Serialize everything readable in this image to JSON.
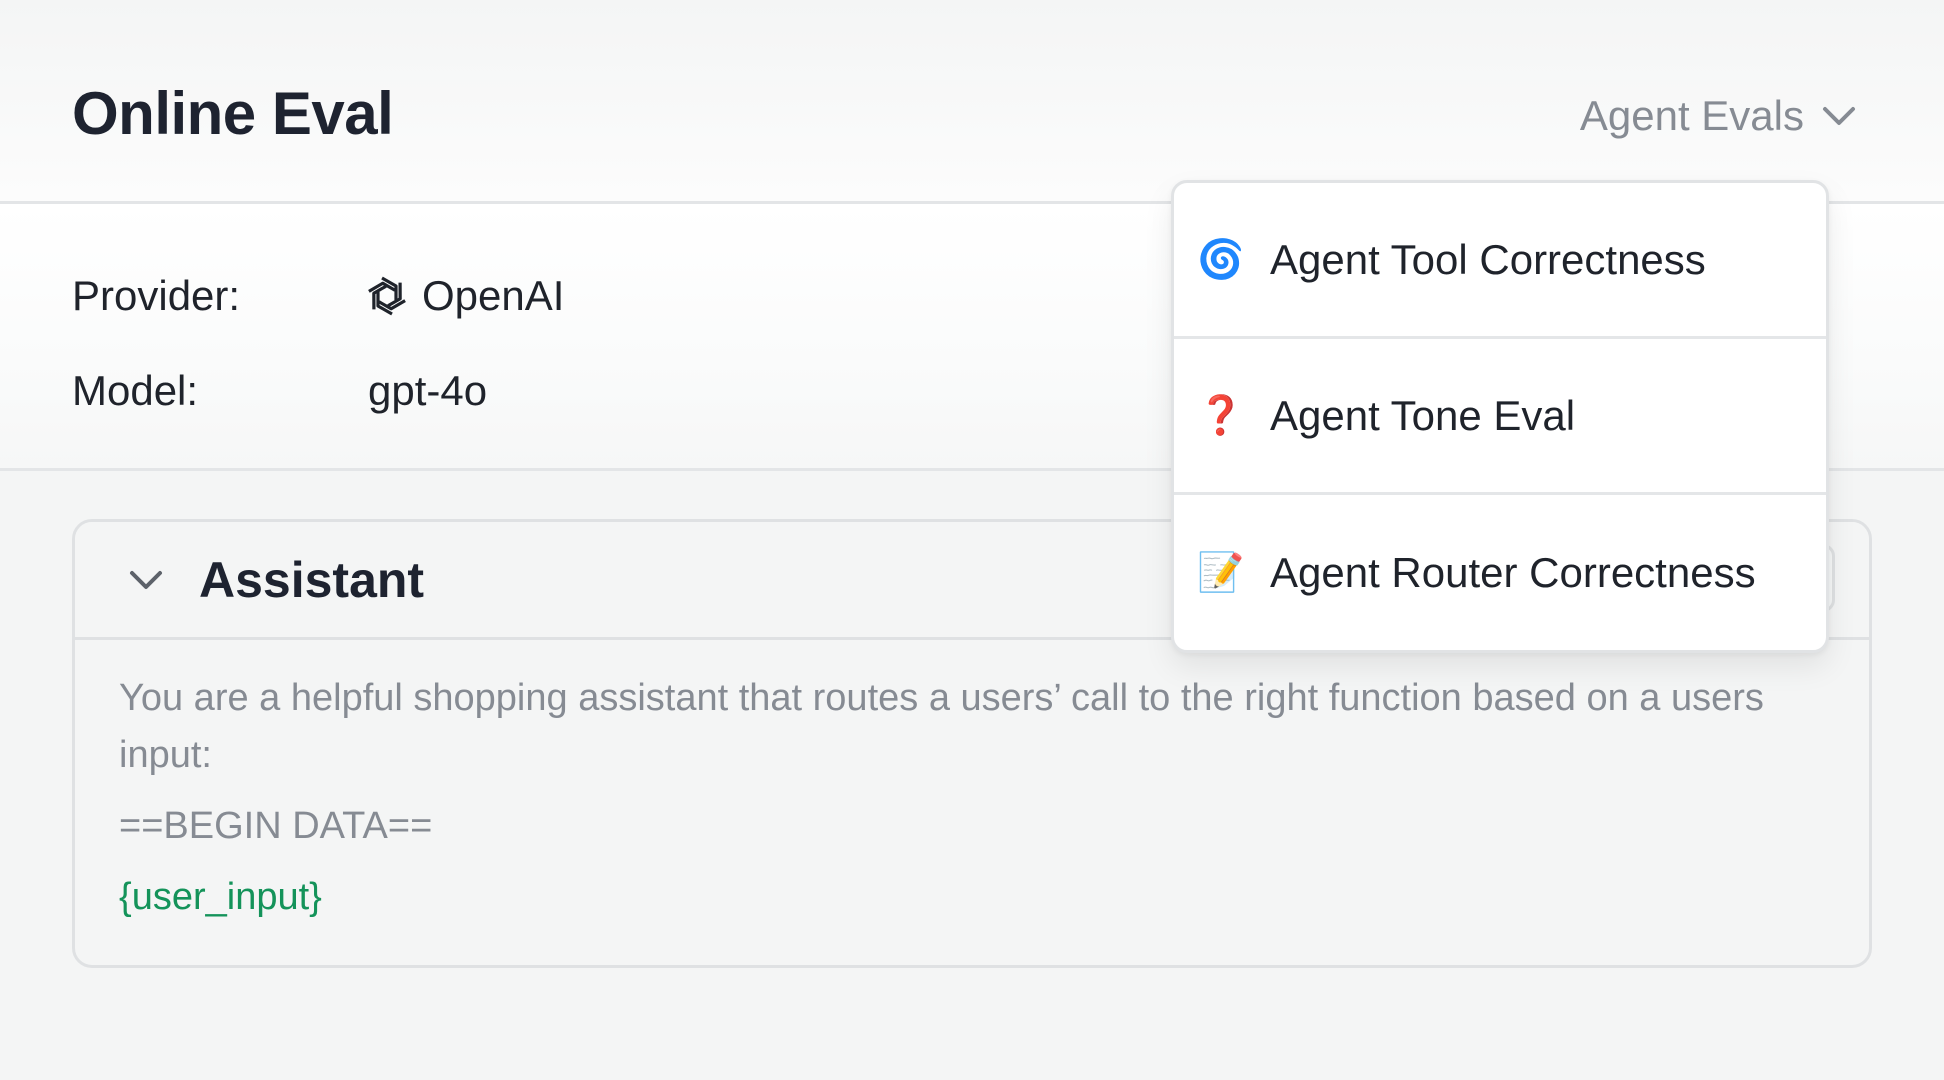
{
  "header": {
    "title": "Online Eval",
    "eval_group": {
      "selected": "Agent Evals",
      "icon": "chevron-down-icon"
    }
  },
  "config": {
    "provider_label": "Provider:",
    "provider_value": "OpenAI",
    "provider_icon": "openai-logo-icon",
    "model_label": "Model:",
    "model_value": "gpt-4o"
  },
  "assistant_card": {
    "title": "Assistant",
    "prompt": {
      "text": "You are a helpful shopping assistant that routes a users’ call to the right function based on a users input:",
      "begin_marker": "==BEGIN DATA==",
      "variable": "{user_input}"
    }
  },
  "dropdown_menu": {
    "items": [
      {
        "icon": "🌀",
        "icon_name": "cyclone-icon",
        "label": "Agent Tool Correctness"
      },
      {
        "icon": "❓",
        "icon_name": "question-mark-icon",
        "label": "Agent Tone Eval"
      },
      {
        "icon": "📝",
        "icon_name": "memo-icon",
        "label": "Agent Router Correctness"
      }
    ]
  },
  "colors": {
    "title_text": "#1e2330",
    "muted_text": "#868b93",
    "variable_green": "#14935a",
    "border": "#e3e5e7",
    "background": "#f4f5f5"
  }
}
